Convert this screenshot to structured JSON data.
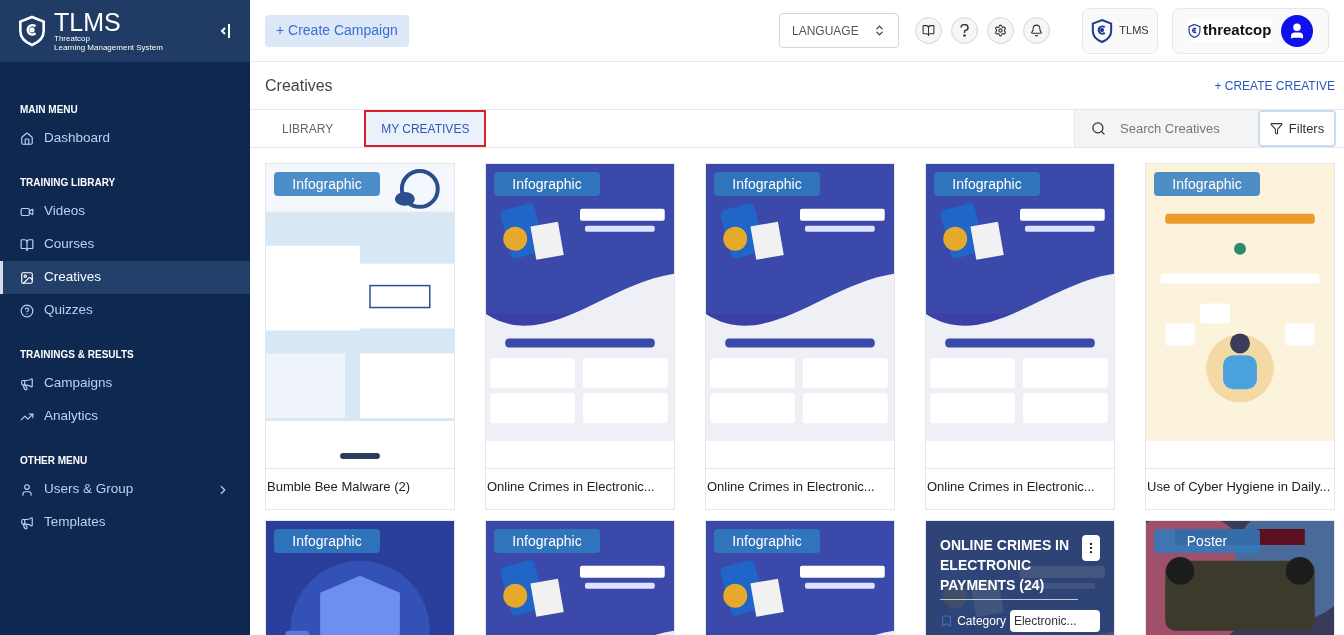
{
  "brand": {
    "name": "TLMS",
    "line_1": "Threatcop",
    "line_2": "Learning Management System"
  },
  "sidebar": {
    "sections": [
      {
        "heading": "MAIN MENU",
        "items": [
          {
            "label": "Dashboard",
            "selected": false,
            "submenu": false
          }
        ]
      },
      {
        "heading": "TRAINING LIBRARY",
        "items": [
          {
            "label": "Videos",
            "selected": false,
            "submenu": false
          },
          {
            "label": "Courses",
            "selected": false,
            "submenu": false
          },
          {
            "label": "Creatives",
            "selected": true,
            "submenu": false
          },
          {
            "label": "Quizzes",
            "selected": false,
            "submenu": false
          }
        ]
      },
      {
        "heading": "TRAININGS & RESULTS",
        "items": [
          {
            "label": "Campaigns",
            "selected": false,
            "submenu": false
          },
          {
            "label": "Analytics",
            "selected": false,
            "submenu": false
          }
        ]
      },
      {
        "heading": "OTHER MENU",
        "items": [
          {
            "label": "Users & Group",
            "selected": false,
            "submenu": true
          },
          {
            "label": "Templates",
            "selected": false,
            "submenu": false
          }
        ]
      }
    ]
  },
  "topbar": {
    "create_button": "+ Create Campaign",
    "language": "LANGUAGE",
    "product": "TLMS",
    "company": "threatcop"
  },
  "page": {
    "title": "Creatives",
    "create_link": "+ CREATE CREATIVE"
  },
  "tabs": [
    {
      "label": "LIBRARY",
      "selected": false
    },
    {
      "label": "MY CREATIVES",
      "selected": true
    }
  ],
  "search": {
    "placeholder": "Search Creatives"
  },
  "filters_button": "Filters",
  "cards": [
    {
      "kind": "normal",
      "badge": "Infographic",
      "title": "Bumble Bee Malware (2)"
    },
    {
      "kind": "normal",
      "badge": "Infographic",
      "title": "Online Crimes in Electronic..."
    },
    {
      "kind": "normal",
      "badge": "Infographic",
      "title": "Online Crimes in Electronic..."
    },
    {
      "kind": "normal",
      "badge": "Infographic",
      "title": "Online Crimes in Electronic..."
    },
    {
      "kind": "normal",
      "badge": "Infographic",
      "title": "Use of Cyber Hygiene in Daily..."
    },
    {
      "kind": "normal",
      "badge": "Infographic"
    },
    {
      "kind": "normal",
      "badge": "Infographic"
    },
    {
      "kind": "normal",
      "badge": "Infographic"
    },
    {
      "kind": "hover",
      "overlay_title": "ONLINE CRIMES IN ELECTRONIC PAYMENTS (24)",
      "category_label": "Category",
      "category_value": "Electronic..."
    },
    {
      "kind": "normal",
      "badge": "Poster"
    }
  ]
}
